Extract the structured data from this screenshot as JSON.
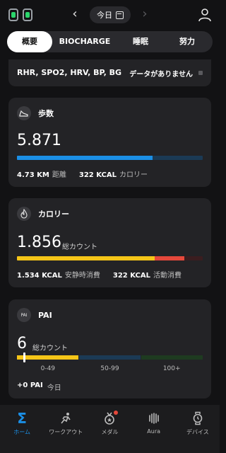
{
  "header": {
    "date_label": "今日"
  },
  "tabs": [
    {
      "label": "概要"
    },
    {
      "label": "BIOCHARGE"
    },
    {
      "label": "睡眠"
    },
    {
      "label": "努力"
    }
  ],
  "metrics": {
    "list": "RHR, SPO2, HRV, BP, BG",
    "status": "データがありません"
  },
  "steps": {
    "title": "歩数",
    "value": "5.871",
    "progress": 0.73,
    "distance_value": "4.73 KM",
    "distance_label": "距離",
    "calorie_value": "322 KCAL",
    "calorie_label": "カロリー",
    "bar_color": "#1b8fe6",
    "bar_track_color": "#1b3a55"
  },
  "calories": {
    "title": "カロリー",
    "value": "1.856",
    "unit": "総カウント",
    "resting_value": "1.534 KCAL",
    "resting_label": "安静時消費",
    "active_value": "322 KCAL",
    "active_label": "活動消費",
    "resting_fraction": 0.74,
    "active_fraction": 0.16,
    "resting_color": "#f5c518",
    "active_color": "#e5483b"
  },
  "pai": {
    "title": "PAI",
    "icon_text": "PAI",
    "value": "6",
    "unit": "総カウント",
    "ranges": [
      "0-49",
      "50-99",
      "100+"
    ],
    "today_value": "+0 PAI",
    "today_label": "今日",
    "colors": [
      "#f5c518",
      "#1b3a55",
      "#1e3b20"
    ]
  },
  "bottom_nav": [
    {
      "label": "ホーム",
      "icon": "sigma-icon",
      "active": true
    },
    {
      "label": "ワークアウト",
      "icon": "running-icon",
      "active": false
    },
    {
      "label": "メダル",
      "icon": "medal-icon",
      "active": false
    },
    {
      "label": "Aura",
      "icon": "aura-icon",
      "active": false
    },
    {
      "label": "デバイス",
      "icon": "watch-icon",
      "active": false
    }
  ]
}
